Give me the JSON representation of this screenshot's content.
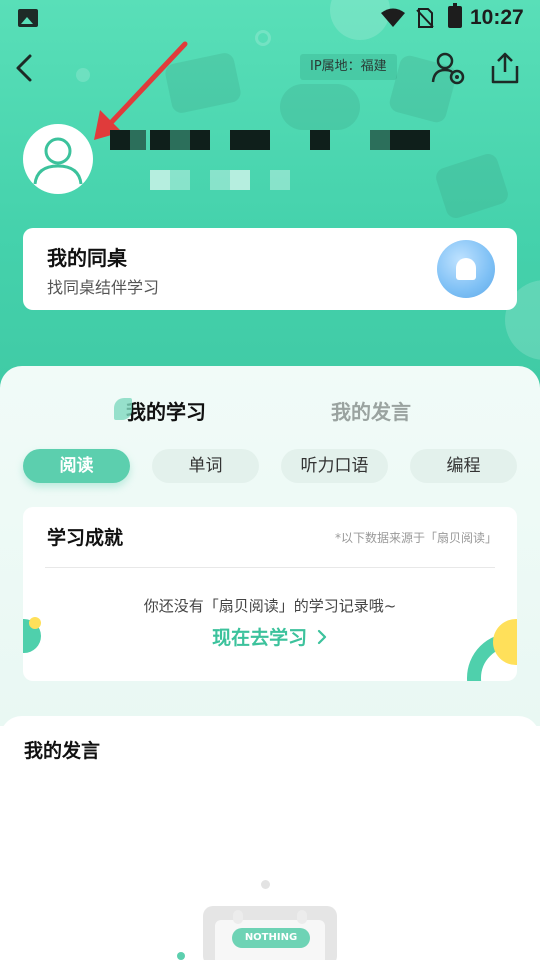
{
  "status_bar": {
    "time": "10:27"
  },
  "header": {
    "ip_location": "IP属地：福建"
  },
  "icons": {
    "back": "back-chevron-icon",
    "user_settings": "user-settings-icon",
    "share": "share-icon",
    "avatar": "default-avatar-icon",
    "annotation_arrow": "red-arrow-annotation"
  },
  "deskmate_card": {
    "title": "我的同桌",
    "subtitle": "找同桌结伴学习"
  },
  "study": {
    "tabs": [
      {
        "label": "我的学习",
        "active": true
      },
      {
        "label": "我的发言",
        "active": false
      }
    ],
    "categories": [
      {
        "label": "阅读",
        "active": true
      },
      {
        "label": "单词",
        "active": false
      },
      {
        "label": "听力口语",
        "active": false
      },
      {
        "label": "编程",
        "active": false
      }
    ],
    "achievement": {
      "title": "学习成就",
      "note": "*以下数据来源于「扇贝阅读」",
      "empty_text": "你还没有「扇贝阅读」的学习记录哦~",
      "cta": "现在去学习"
    }
  },
  "posts": {
    "title": "我的发言",
    "empty_label": "NOTHING"
  },
  "colors": {
    "brand": "#45d2ac",
    "accent_text": "#3cc29c",
    "chip_active": "#5ccfae",
    "annotation_red": "#e03b3b"
  }
}
